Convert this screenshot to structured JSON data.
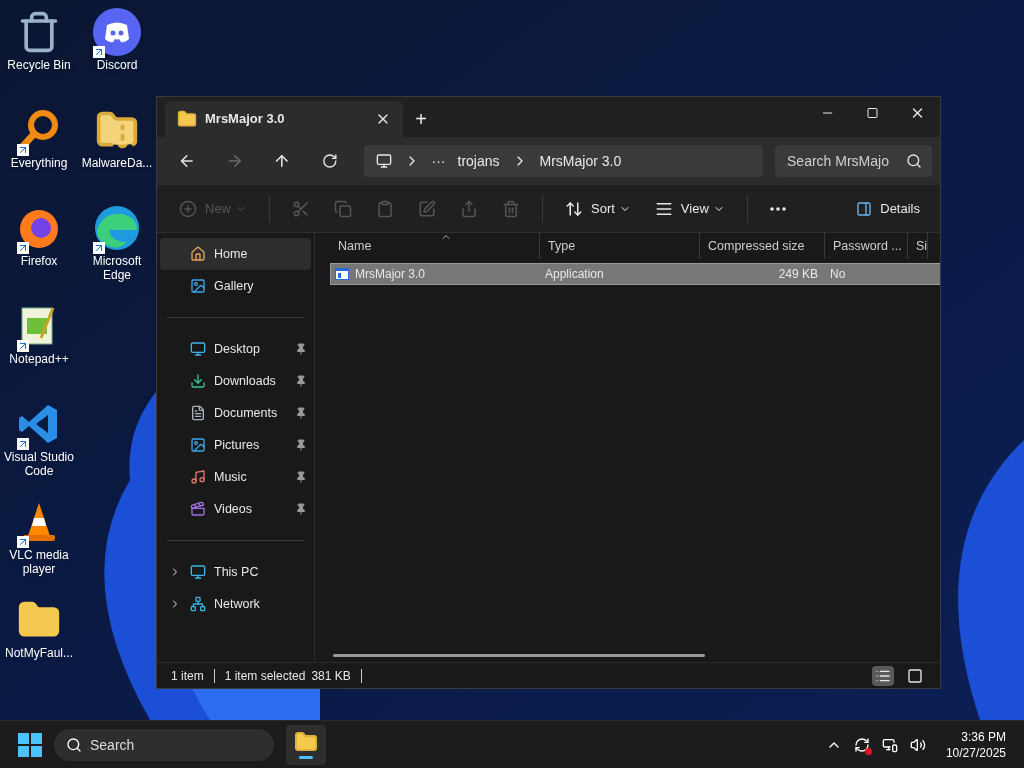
{
  "desktop": {
    "columns": [
      [
        {
          "label": "Recycle Bin",
          "kind": "recycle",
          "shortcut": false
        },
        {
          "label": "Everything",
          "kind": "everything",
          "shortcut": true
        },
        {
          "label": "Firefox",
          "kind": "firefox",
          "shortcut": true
        },
        {
          "label": "Notepad++",
          "kind": "notepad",
          "shortcut": true
        },
        {
          "label": "Visual Studio Code",
          "kind": "vscode",
          "shortcut": true
        },
        {
          "label": "VLC media player",
          "kind": "vlc",
          "shortcut": true
        },
        {
          "label": "NotMyFaul...",
          "kind": "folder",
          "shortcut": false
        }
      ],
      [
        {
          "label": "Discord",
          "kind": "discord",
          "shortcut": true
        },
        {
          "label": "MalwareDa...",
          "kind": "zip",
          "shortcut": false
        },
        {
          "label": "Microsoft Edge",
          "kind": "edge",
          "shortcut": true
        }
      ]
    ]
  },
  "window": {
    "tab": {
      "title": "MrsMajor 3.0",
      "new_tab": "+"
    },
    "address": {
      "overflow": "···",
      "crumbs": [
        "trojans",
        "MrsMajor 3.0"
      ],
      "search_placeholder": "Search MrsMajo"
    },
    "toolbar": [
      {
        "kind": "new",
        "label": "New",
        "disabled": true
      },
      {
        "kind": "cut",
        "disabled": true
      },
      {
        "kind": "copy",
        "disabled": true
      },
      {
        "kind": "paste",
        "disabled": true
      },
      {
        "kind": "rename",
        "disabled": true
      },
      {
        "kind": "share",
        "disabled": true
      },
      {
        "kind": "delete",
        "disabled": true
      },
      {
        "kind": "sort",
        "label": "Sort",
        "disabled": false
      },
      {
        "kind": "view",
        "label": "View",
        "disabled": false
      },
      {
        "kind": "more",
        "disabled": false
      }
    ],
    "details_button": "Details",
    "sidebar": {
      "groups": [
        [
          {
            "label": "Home",
            "kind": "home",
            "selected": true,
            "pinned": false,
            "expandable": false
          },
          {
            "label": "Gallery",
            "kind": "gallery",
            "selected": false,
            "pinned": false,
            "expandable": false
          }
        ],
        [
          {
            "label": "Desktop",
            "kind": "desktop",
            "selected": false,
            "pinned": true,
            "expandable": false
          },
          {
            "label": "Downloads",
            "kind": "downloads",
            "selected": false,
            "pinned": true,
            "expandable": false
          },
          {
            "label": "Documents",
            "kind": "documents",
            "selected": false,
            "pinned": true,
            "expandable": false
          },
          {
            "label": "Pictures",
            "kind": "pictures",
            "selected": false,
            "pinned": true,
            "expandable": false
          },
          {
            "label": "Music",
            "kind": "music",
            "selected": false,
            "pinned": true,
            "expandable": false
          },
          {
            "label": "Videos",
            "kind": "videos",
            "selected": false,
            "pinned": true,
            "expandable": false
          }
        ],
        [
          {
            "label": "This PC",
            "kind": "pc",
            "selected": false,
            "pinned": false,
            "expandable": true
          },
          {
            "label": "Network",
            "kind": "network",
            "selected": false,
            "pinned": false,
            "expandable": true
          }
        ]
      ]
    },
    "table": {
      "columns": [
        "Name",
        "Type",
        "Compressed size",
        "Password ...",
        "Si"
      ],
      "rows": [
        {
          "selected": true,
          "cells": [
            "MrsMajor 3.0",
            "Application",
            "249 KB",
            "No"
          ]
        }
      ]
    },
    "status_bar": {
      "items": "1 item",
      "selection": "1 item selected",
      "size": "381 KB",
      "views": [
        {
          "kind": "details",
          "selected": true
        },
        {
          "kind": "tiles",
          "selected": false
        }
      ]
    }
  },
  "taskbar": {
    "search_placeholder": "Search",
    "time": "3:36 PM",
    "date": "10/27/2025"
  }
}
